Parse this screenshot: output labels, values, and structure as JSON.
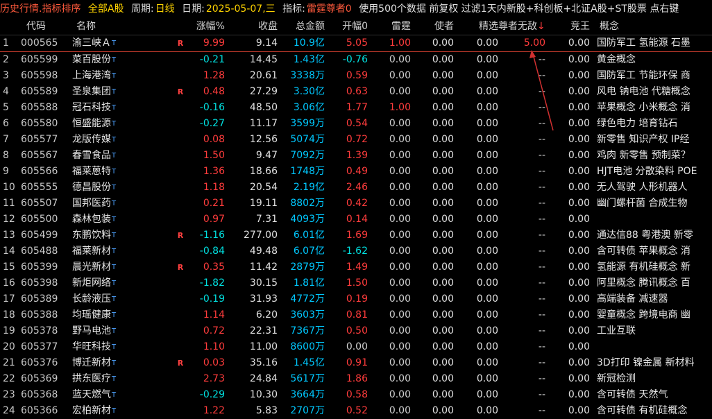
{
  "titlebar": {
    "title": "历史行情.指标排序",
    "market": "全部A股",
    "period_label": "周期:",
    "period_value": "日线",
    "date_label": "日期:",
    "date_value": "2025-05-07,三",
    "indicator_label": "指标:",
    "indicator_value": "雷霆尊者0",
    "info": "使用500个数据 前复权 过滤1天内新股+科创板+北证A股+ST股票 点右键"
  },
  "headers": {
    "code": "代码",
    "name": "名称",
    "chg": "涨幅%",
    "close": "收盘",
    "amount": "总金额",
    "open": "开幅0",
    "leiting": "雷霆",
    "shizhe": "使者",
    "jingxuan": "精选尊者无敌",
    "sort_arrow": "↓",
    "jingwang": "竞王",
    "concept": "概念"
  },
  "colors": {
    "up": "#ff3c3c",
    "down": "#00e0e0",
    "amount": "#00c8ff",
    "bg": "#000000"
  },
  "rows": [
    {
      "idx": "1",
      "code": "000565",
      "name": "渝三峡Ａ",
      "t": "T",
      "r": "R",
      "chg": "9.99",
      "chg_dir": "up",
      "close": "9.14",
      "amount": "10.9亿",
      "open": "5.05",
      "open_dir": "up",
      "leiting": "1.00",
      "leiting_dir": "up",
      "shizhe": "0.00",
      "jingxuan": "0.00",
      "zunzhe": "5.00",
      "zunzhe_dir": "up",
      "jingwang": "0.00",
      "concept": "国防军工 氢能源 石墨"
    },
    {
      "idx": "2",
      "code": "605599",
      "name": "菜百股份",
      "t": "T",
      "r": "",
      "chg": "-0.21",
      "chg_dir": "down",
      "close": "14.45",
      "amount": "1.43亿",
      "open": "-0.76",
      "open_dir": "down",
      "leiting": "0.00",
      "leiting_dir": "flat",
      "shizhe": "0.00",
      "jingxuan": "0.00",
      "zunzhe": "--",
      "zunzhe_dir": "flat",
      "jingwang": "0.00",
      "concept": "黄金概念"
    },
    {
      "idx": "3",
      "code": "605598",
      "name": "上海港湾",
      "t": "T",
      "r": "",
      "chg": "1.28",
      "chg_dir": "up",
      "close": "20.61",
      "amount": "3338万",
      "open": "0.59",
      "open_dir": "up",
      "leiting": "0.00",
      "leiting_dir": "flat",
      "shizhe": "0.00",
      "jingxuan": "0.00",
      "zunzhe": "--",
      "zunzhe_dir": "flat",
      "jingwang": "0.00",
      "concept": "国防军工 节能环保 商"
    },
    {
      "idx": "4",
      "code": "605589",
      "name": "圣泉集团",
      "t": "T",
      "r": "R",
      "chg": "0.48",
      "chg_dir": "up",
      "close": "27.29",
      "amount": "3.30亿",
      "open": "0.63",
      "open_dir": "up",
      "leiting": "0.00",
      "leiting_dir": "flat",
      "shizhe": "0.00",
      "jingxuan": "0.00",
      "zunzhe": "--",
      "zunzhe_dir": "flat",
      "jingwang": "0.00",
      "concept": "风电 钠电池 代糖概念"
    },
    {
      "idx": "5",
      "code": "605588",
      "name": "冠石科技",
      "t": "T",
      "r": "",
      "chg": "-0.16",
      "chg_dir": "down",
      "close": "48.50",
      "amount": "3.06亿",
      "open": "1.77",
      "open_dir": "up",
      "leiting": "1.00",
      "leiting_dir": "up",
      "shizhe": "0.00",
      "jingxuan": "0.00",
      "zunzhe": "--",
      "zunzhe_dir": "flat",
      "jingwang": "0.00",
      "concept": "苹果概念 小米概念 消"
    },
    {
      "idx": "6",
      "code": "605580",
      "name": "恒盛能源",
      "t": "T",
      "r": "",
      "chg": "-0.27",
      "chg_dir": "down",
      "close": "11.17",
      "amount": "3599万",
      "open": "0.54",
      "open_dir": "up",
      "leiting": "0.00",
      "leiting_dir": "flat",
      "shizhe": "0.00",
      "jingxuan": "0.00",
      "zunzhe": "--",
      "zunzhe_dir": "flat",
      "jingwang": "0.00",
      "concept": "绿色电力 培育钻石"
    },
    {
      "idx": "7",
      "code": "605577",
      "name": "龙版传媒",
      "t": "T",
      "r": "",
      "chg": "0.08",
      "chg_dir": "up",
      "close": "12.56",
      "amount": "5074万",
      "open": "0.72",
      "open_dir": "up",
      "leiting": "0.00",
      "leiting_dir": "flat",
      "shizhe": "0.00",
      "jingxuan": "0.00",
      "zunzhe": "--",
      "zunzhe_dir": "flat",
      "jingwang": "0.00",
      "concept": "新零售 知识产权 IP经"
    },
    {
      "idx": "8",
      "code": "605567",
      "name": "春雪食品",
      "t": "T",
      "r": "",
      "chg": "1.50",
      "chg_dir": "up",
      "close": "9.47",
      "amount": "7092万",
      "open": "1.39",
      "open_dir": "up",
      "leiting": "0.00",
      "leiting_dir": "flat",
      "shizhe": "0.00",
      "jingxuan": "0.00",
      "zunzhe": "--",
      "zunzhe_dir": "flat",
      "jingwang": "0.00",
      "concept": "鸡肉 新零售 预制菜？"
    },
    {
      "idx": "9",
      "code": "605566",
      "name": "福莱蒽特",
      "t": "T",
      "r": "",
      "chg": "1.36",
      "chg_dir": "up",
      "close": "18.66",
      "amount": "1748万",
      "open": "0.49",
      "open_dir": "up",
      "leiting": "0.00",
      "leiting_dir": "flat",
      "shizhe": "0.00",
      "jingxuan": "0.00",
      "zunzhe": "--",
      "zunzhe_dir": "flat",
      "jingwang": "0.00",
      "concept": "HJT电池 分散染料 POE"
    },
    {
      "idx": "10",
      "code": "605555",
      "name": "德昌股份",
      "t": "T",
      "r": "",
      "chg": "1.18",
      "chg_dir": "up",
      "close": "20.54",
      "amount": "2.19亿",
      "open": "2.46",
      "open_dir": "up",
      "leiting": "0.00",
      "leiting_dir": "flat",
      "shizhe": "0.00",
      "jingxuan": "0.00",
      "zunzhe": "--",
      "zunzhe_dir": "flat",
      "jingwang": "0.00",
      "concept": "无人驾驶 人形机器人"
    },
    {
      "idx": "11",
      "code": "605507",
      "name": "国邦医药",
      "t": "T",
      "r": "",
      "chg": "0.21",
      "chg_dir": "up",
      "close": "19.11",
      "amount": "8802万",
      "open": "0.42",
      "open_dir": "up",
      "leiting": "0.00",
      "leiting_dir": "flat",
      "shizhe": "0.00",
      "jingxuan": "0.00",
      "zunzhe": "--",
      "zunzhe_dir": "flat",
      "jingwang": "0.00",
      "concept": "幽门螺杆菌 合成生物"
    },
    {
      "idx": "12",
      "code": "605500",
      "name": "森林包装",
      "t": "T",
      "r": "",
      "chg": "0.97",
      "chg_dir": "up",
      "close": "7.31",
      "amount": "4093万",
      "open": "0.14",
      "open_dir": "up",
      "leiting": "0.00",
      "leiting_dir": "flat",
      "shizhe": "0.00",
      "jingxuan": "0.00",
      "zunzhe": "--",
      "zunzhe_dir": "flat",
      "jingwang": "0.00",
      "concept": ""
    },
    {
      "idx": "13",
      "code": "605499",
      "name": "东鹏饮料",
      "t": "T",
      "r": "R",
      "chg": "-1.16",
      "chg_dir": "down",
      "close": "277.00",
      "amount": "6.01亿",
      "open": "1.69",
      "open_dir": "up",
      "leiting": "0.00",
      "leiting_dir": "flat",
      "shizhe": "0.00",
      "jingxuan": "0.00",
      "zunzhe": "--",
      "zunzhe_dir": "flat",
      "jingwang": "0.00",
      "concept": "通达信88 粤港澳 新零"
    },
    {
      "idx": "14",
      "code": "605488",
      "name": "福莱新材",
      "t": "T",
      "r": "",
      "chg": "-0.84",
      "chg_dir": "down",
      "close": "49.48",
      "amount": "6.07亿",
      "open": "-1.62",
      "open_dir": "down",
      "leiting": "0.00",
      "leiting_dir": "flat",
      "shizhe": "0.00",
      "jingxuan": "0.00",
      "zunzhe": "--",
      "zunzhe_dir": "flat",
      "jingwang": "0.00",
      "concept": "含可转债 苹果概念 消"
    },
    {
      "idx": "15",
      "code": "605399",
      "name": "晨光新材",
      "t": "T",
      "r": "R",
      "chg": "0.35",
      "chg_dir": "up",
      "close": "11.42",
      "amount": "2879万",
      "open": "1.49",
      "open_dir": "up",
      "leiting": "0.00",
      "leiting_dir": "flat",
      "shizhe": "0.00",
      "jingxuan": "0.00",
      "zunzhe": "--",
      "zunzhe_dir": "flat",
      "jingwang": "0.00",
      "concept": "氢能源 有机硅概念 新"
    },
    {
      "idx": "16",
      "code": "605398",
      "name": "新炬网络",
      "t": "T",
      "r": "",
      "chg": "-1.82",
      "chg_dir": "down",
      "close": "30.15",
      "amount": "1.81亿",
      "open": "1.50",
      "open_dir": "up",
      "leiting": "0.00",
      "leiting_dir": "flat",
      "shizhe": "0.00",
      "jingxuan": "0.00",
      "zunzhe": "--",
      "zunzhe_dir": "flat",
      "jingwang": "0.00",
      "concept": "阿里概念 腾讯概念 百"
    },
    {
      "idx": "17",
      "code": "605389",
      "name": "长龄液压",
      "t": "T",
      "r": "",
      "chg": "-0.19",
      "chg_dir": "down",
      "close": "31.93",
      "amount": "4772万",
      "open": "0.19",
      "open_dir": "up",
      "leiting": "0.00",
      "leiting_dir": "flat",
      "shizhe": "0.00",
      "jingxuan": "0.00",
      "zunzhe": "--",
      "zunzhe_dir": "flat",
      "jingwang": "0.00",
      "concept": "高端装备 减速器"
    },
    {
      "idx": "18",
      "code": "605388",
      "name": "均瑶健康",
      "t": "T",
      "r": "",
      "chg": "1.14",
      "chg_dir": "up",
      "close": "6.20",
      "amount": "3603万",
      "open": "0.81",
      "open_dir": "up",
      "leiting": "0.00",
      "leiting_dir": "flat",
      "shizhe": "0.00",
      "jingxuan": "0.00",
      "zunzhe": "--",
      "zunzhe_dir": "flat",
      "jingwang": "0.00",
      "concept": "婴童概念 跨境电商 幽"
    },
    {
      "idx": "19",
      "code": "605378",
      "name": "野马电池",
      "t": "T",
      "r": "",
      "chg": "0.72",
      "chg_dir": "up",
      "close": "22.31",
      "amount": "7367万",
      "open": "0.50",
      "open_dir": "up",
      "leiting": "0.00",
      "leiting_dir": "flat",
      "shizhe": "0.00",
      "jingxuan": "0.00",
      "zunzhe": "--",
      "zunzhe_dir": "flat",
      "jingwang": "0.00",
      "concept": "工业互联"
    },
    {
      "idx": "20",
      "code": "605377",
      "name": "华旺科技",
      "t": "T",
      "r": "",
      "chg": "1.10",
      "chg_dir": "up",
      "close": "11.00",
      "amount": "8600万",
      "open": "0.00",
      "open_dir": "flat",
      "leiting": "0.00",
      "leiting_dir": "flat",
      "shizhe": "0.00",
      "jingxuan": "0.00",
      "zunzhe": "--",
      "zunzhe_dir": "flat",
      "jingwang": "0.00",
      "concept": ""
    },
    {
      "idx": "21",
      "code": "605376",
      "name": "博迁新材",
      "t": "T",
      "r": "R",
      "chg": "0.03",
      "chg_dir": "up",
      "close": "35.16",
      "amount": "1.45亿",
      "open": "0.91",
      "open_dir": "up",
      "leiting": "0.00",
      "leiting_dir": "flat",
      "shizhe": "0.00",
      "jingxuan": "0.00",
      "zunzhe": "--",
      "zunzhe_dir": "flat",
      "jingwang": "0.00",
      "concept": "3D打印 镍金属 新材料"
    },
    {
      "idx": "22",
      "code": "605369",
      "name": "拱东医疗",
      "t": "T",
      "r": "",
      "chg": "2.73",
      "chg_dir": "up",
      "close": "24.84",
      "amount": "5617万",
      "open": "1.86",
      "open_dir": "up",
      "leiting": "0.00",
      "leiting_dir": "flat",
      "shizhe": "0.00",
      "jingxuan": "0.00",
      "zunzhe": "--",
      "zunzhe_dir": "flat",
      "jingwang": "0.00",
      "concept": "新冠检测"
    },
    {
      "idx": "23",
      "code": "605368",
      "name": "蓝天燃气",
      "t": "T",
      "r": "",
      "chg": "-0.29",
      "chg_dir": "down",
      "close": "10.30",
      "amount": "3664万",
      "open": "0.58",
      "open_dir": "up",
      "leiting": "0.00",
      "leiting_dir": "flat",
      "shizhe": "0.00",
      "jingxuan": "0.00",
      "zunzhe": "--",
      "zunzhe_dir": "flat",
      "jingwang": "0.00",
      "concept": "含可转债 天然气"
    },
    {
      "idx": "24",
      "code": "605366",
      "name": "宏柏新材",
      "t": "T",
      "r": "",
      "chg": "1.22",
      "chg_dir": "up",
      "close": "5.83",
      "amount": "2707万",
      "open": "0.52",
      "open_dir": "up",
      "leiting": "0.00",
      "leiting_dir": "flat",
      "shizhe": "0.00",
      "jingxuan": "0.00",
      "zunzhe": "--",
      "zunzhe_dir": "flat",
      "jingwang": "0.00",
      "concept": "含可转债 有机硅概念"
    }
  ]
}
